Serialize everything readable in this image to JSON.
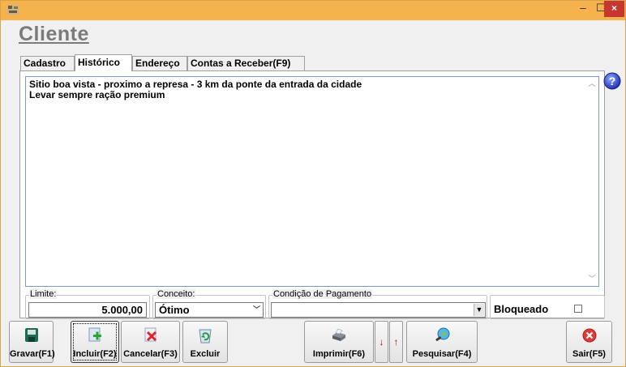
{
  "window": {
    "title": "",
    "controls": {
      "minimize": "–",
      "maximize": "☐",
      "close": "×"
    }
  },
  "page": {
    "title": "Cliente"
  },
  "tabs": [
    {
      "label": "Cadastro",
      "active": false
    },
    {
      "label": "Histórico",
      "active": true
    },
    {
      "label": "Endereço",
      "active": false
    },
    {
      "label": "Contas a Receber(F9)",
      "active": false
    }
  ],
  "historico": {
    "lines": [
      "Sitio boa vista - proximo a represa - 3 km da ponte da entrada da cidade",
      "Levar sempre ração premium"
    ]
  },
  "fields": {
    "limite": {
      "label": "Limite:",
      "value": "5.000,00"
    },
    "conceito": {
      "label": "Conceito:",
      "value": "Ótimo"
    },
    "condicao": {
      "label": "Condição de Pagamento",
      "value": ""
    },
    "bloqueado": {
      "label": "Bloqueado",
      "checked": false
    }
  },
  "toolbar": {
    "gravar": "Gravar(F1)",
    "incluir": "Incluir(F2)",
    "cancelar": "Cancelar(F3)",
    "excluir": "Excluir",
    "imprimir": "Imprimir(F6)",
    "down": "↓",
    "up": "↑",
    "pesquisar": "Pesquisar(F4)",
    "sair": "Sair(F5)"
  },
  "colors": {
    "titlebar": "#f6b24c",
    "close": "#c7372f",
    "title_text": "#7b7b7b",
    "arrow": "#c00000"
  },
  "icons": {
    "app": "app-icon",
    "help": "help-icon",
    "gravar": "save-icon",
    "incluir": "add-icon",
    "cancelar": "cancel-icon",
    "excluir": "recycle-bin-icon",
    "imprimir": "printer-icon",
    "pesquisar": "search-globe-icon",
    "sair": "exit-icon"
  }
}
